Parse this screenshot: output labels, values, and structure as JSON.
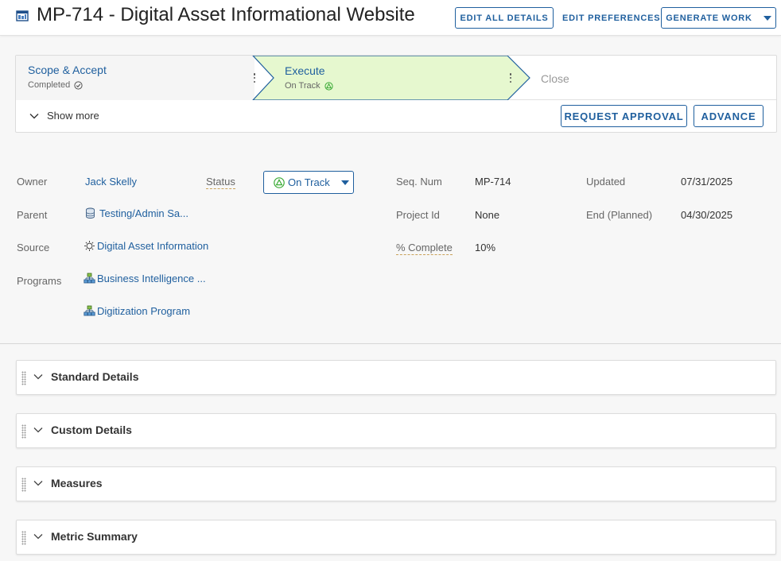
{
  "header": {
    "title": "MP-714 - Digital Asset Informational Website",
    "edit_all_details": "EDIT ALL DETAILS",
    "edit_preferences": "EDIT PREFERENCES",
    "generate_work": "GENERATE WORK"
  },
  "stages": {
    "scope": {
      "name": "Scope & Accept",
      "status": "Completed"
    },
    "execute": {
      "name": "Execute",
      "status": "On Track"
    },
    "close": {
      "name": "Close"
    }
  },
  "stage_actions": {
    "show_more": "Show more",
    "request_approval": "REQUEST APPROVAL",
    "advance": "ADVANCE"
  },
  "details": {
    "owner": {
      "label": "Owner",
      "value": "Jack Skelly"
    },
    "status": {
      "label": "Status",
      "value": "On Track"
    },
    "seq_num": {
      "label": "Seq. Num",
      "value": "MP-714"
    },
    "updated": {
      "label": "Updated",
      "value": "07/31/2025"
    },
    "parent": {
      "label": "Parent",
      "value": "Testing/Admin Sa..."
    },
    "project_id": {
      "label": "Project Id",
      "value": "None"
    },
    "end_planned": {
      "label": "End (Planned)",
      "value": "04/30/2025"
    },
    "source": {
      "label": "Source",
      "value": "Digital Asset Information"
    },
    "percent_complete": {
      "label": "% Complete",
      "value": "10%"
    },
    "programs": {
      "label": "Programs",
      "values": [
        "Business Intelligence ...",
        "Digitization Program"
      ]
    }
  },
  "sections": [
    {
      "title": "Standard Details"
    },
    {
      "title": "Custom Details"
    },
    {
      "title": "Measures"
    },
    {
      "title": "Metric Summary"
    }
  ],
  "colors": {
    "accent": "#1f5f9e",
    "active_stage_bg": "#e6f8cf",
    "status_green": "#3aaa35"
  }
}
